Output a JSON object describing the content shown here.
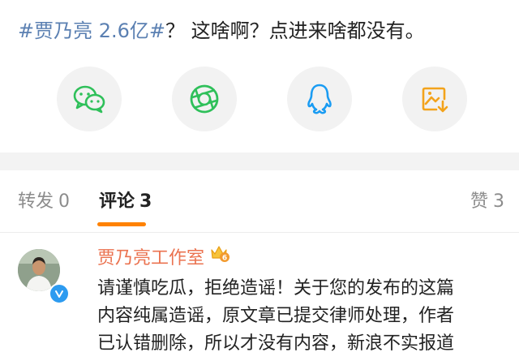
{
  "post": {
    "topic": "#贾乃亮 2.6亿#",
    "text": "？ 这啥啊？点进来啥都没有。"
  },
  "share": [
    {
      "icon": "wechat-icon",
      "color": "#2fc05a"
    },
    {
      "icon": "wechat-moments-icon",
      "color": "#2fc05a"
    },
    {
      "icon": "qq-icon",
      "color": "#1a9cf3"
    },
    {
      "icon": "save-image-icon",
      "color": "#f3a31b"
    }
  ],
  "tabs": {
    "repost_label": "转发",
    "repost_count": "0",
    "comment_label": "评论",
    "comment_count": "3",
    "like_label": "赞",
    "like_count": "3"
  },
  "colors": {
    "accent": "#ff8200",
    "username": "#eb7350",
    "topic": "#5b80b2",
    "verified": "#2d9bf0"
  },
  "comment": {
    "username": "贾乃亮工作室",
    "badge": "6",
    "lines": [
      "请谨慎吃瓜，拒绝造谣！关于您的发布的这篇",
      "内容纯属造谣，原文章已提交律师处理，作者",
      "已认错删除，所以才没有内容，新浪不实报道"
    ]
  }
}
